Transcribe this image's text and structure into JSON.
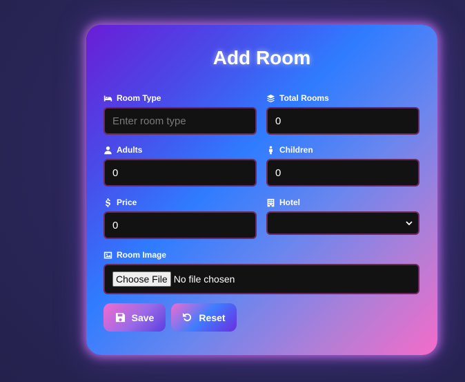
{
  "form": {
    "title": "Add Room",
    "room_type": {
      "label": "Room Type",
      "placeholder": "Enter room type",
      "value": ""
    },
    "total_rooms": {
      "label": "Total Rooms",
      "value": "0"
    },
    "adults": {
      "label": "Adults",
      "value": "0"
    },
    "children": {
      "label": "Children",
      "value": "0"
    },
    "price": {
      "label": "Price",
      "value": "0"
    },
    "hotel": {
      "label": "Hotel",
      "selected": ""
    },
    "room_image": {
      "label": "Room Image",
      "button": "Choose File",
      "status": "No file chosen"
    }
  },
  "actions": {
    "save_label": "Save",
    "reset_label": "Reset"
  },
  "icons": {
    "room_type": "bed-icon",
    "total_rooms": "layers-icon",
    "adults": "user-icon",
    "children": "child-icon",
    "price": "dollar-icon",
    "hotel": "building-icon",
    "room_image": "image-icon",
    "save": "floppy-disk-icon",
    "reset": "undo-icon"
  },
  "colors": {
    "background": "#2a2658",
    "field_bg": "#121212",
    "field_border": "#6b2a5e",
    "gradient_start": "#6a1dd6",
    "gradient_mid": "#2f7cff",
    "gradient_end": "#f46bc9"
  }
}
